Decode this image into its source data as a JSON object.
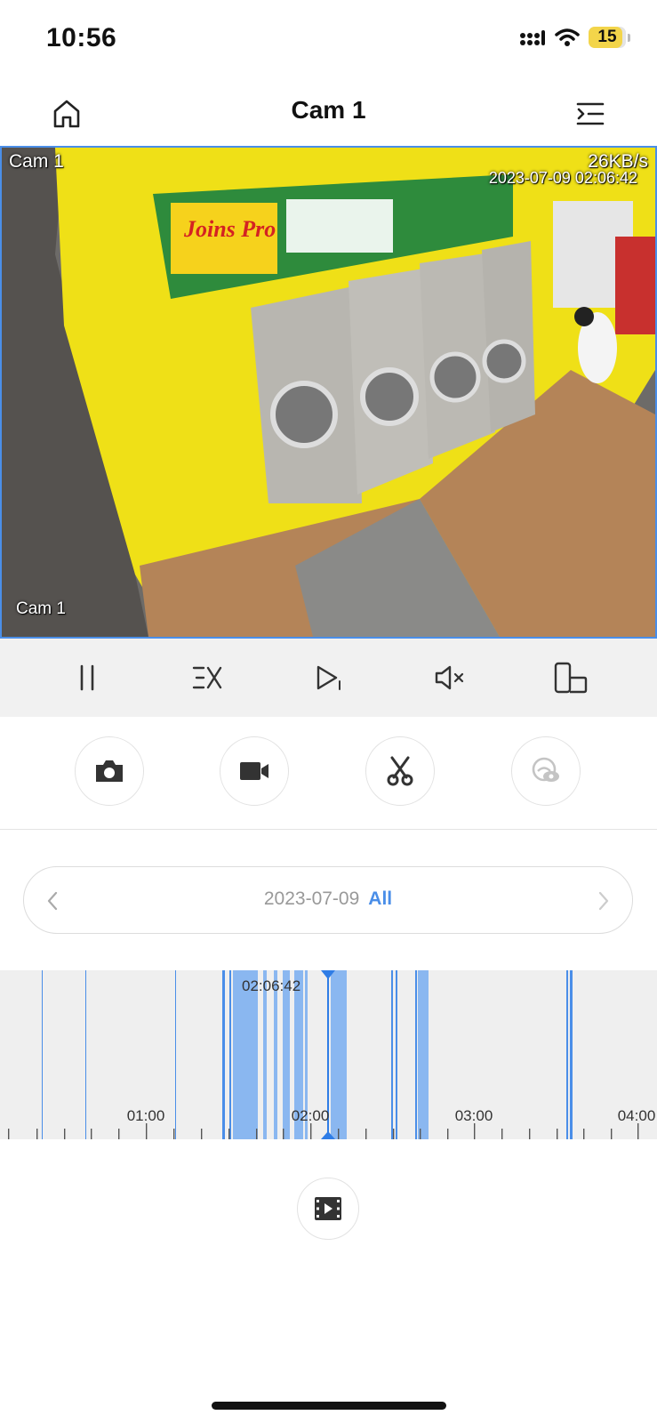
{
  "status": {
    "time": "10:56",
    "battery": "15",
    "battery_level": 0.15
  },
  "nav": {
    "title": "Cam 1",
    "home_icon": "home-icon",
    "menu_icon": "menu-collapse-icon"
  },
  "video": {
    "camera_label_top": "Cam 1",
    "camera_label_bottom": "Cam 1",
    "bitrate": "26KB/s",
    "timestamp": "2023-07-09 02:06:42"
  },
  "controls": [
    "pause-icon",
    "speed-icon",
    "play-step-icon",
    "mute-icon",
    "rotate-screen-icon"
  ],
  "actions": [
    "snapshot-icon",
    "record-icon",
    "clip-scissors-icon",
    "privacy-eye-icon"
  ],
  "date_selector": {
    "date": "2023-07-09",
    "filter": "All"
  },
  "timeline": {
    "current_time": "02:06:42",
    "labels": [
      "01:00",
      "02:00",
      "03:00",
      "04:00"
    ],
    "accent": "#4a8ee8"
  },
  "footer": {
    "clip_icon": "video-clip-icon"
  }
}
